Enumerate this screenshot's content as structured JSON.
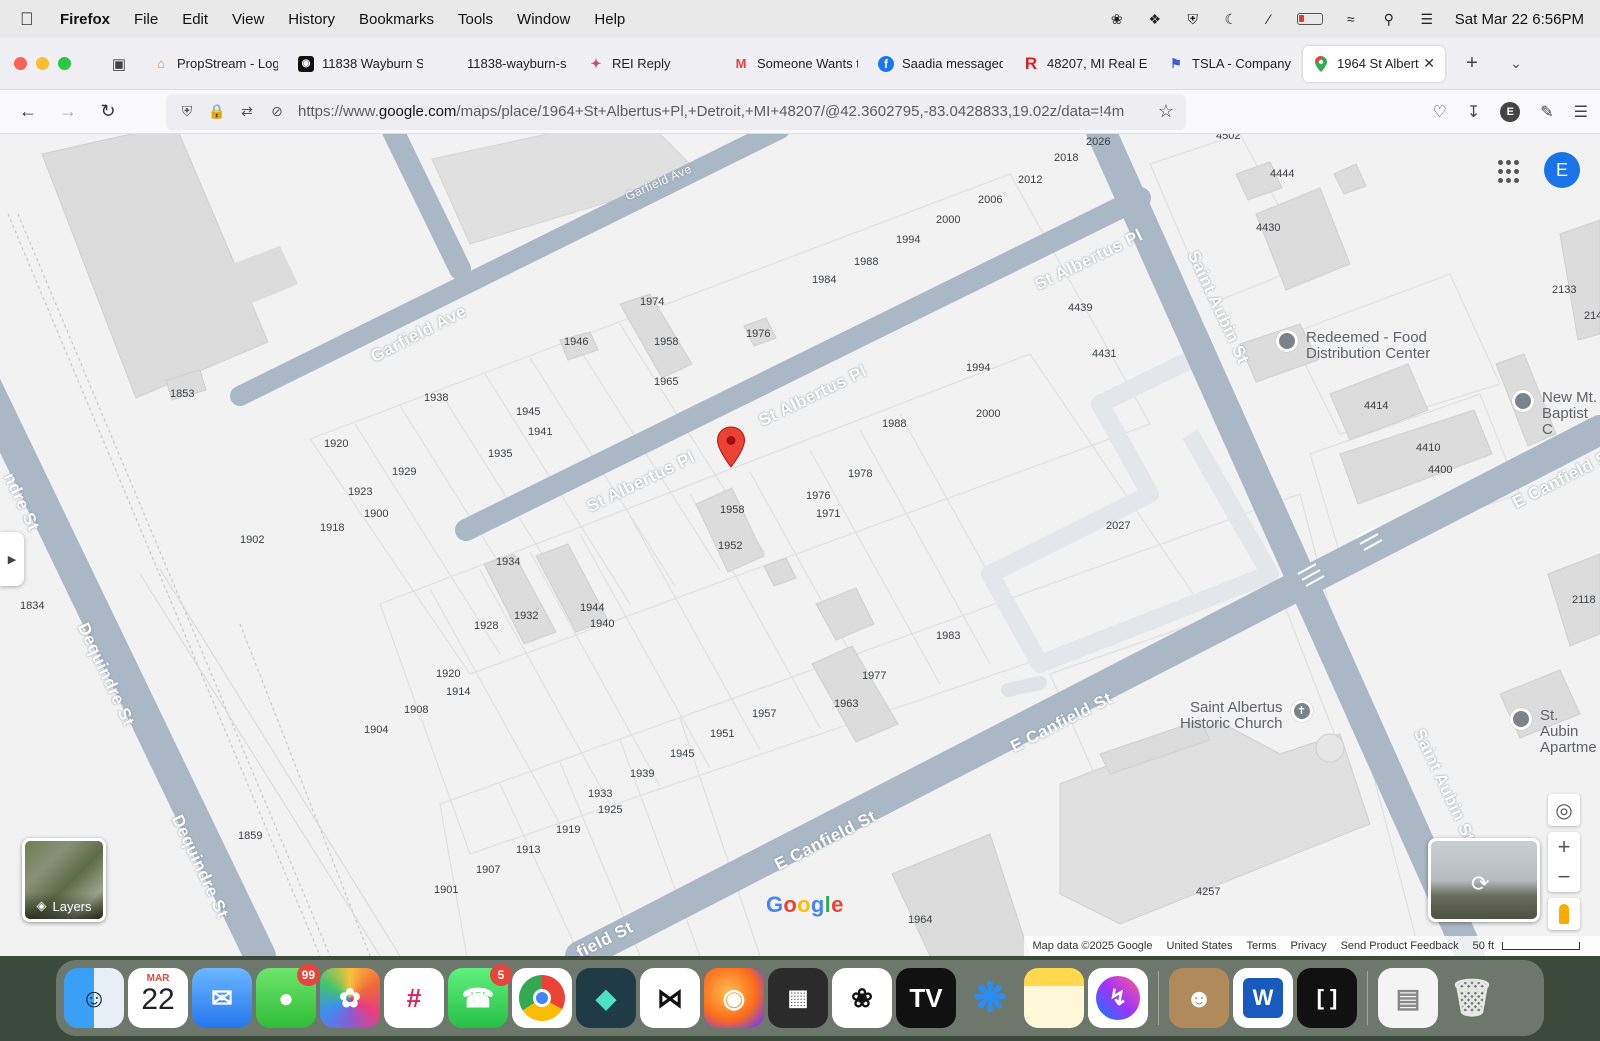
{
  "menubar": {
    "app": "Firefox",
    "items": [
      "File",
      "Edit",
      "View",
      "History",
      "Bookmarks",
      "Tools",
      "Window",
      "Help"
    ],
    "datetime": "Sat Mar 22  6:56PM"
  },
  "tabs": [
    {
      "label": "PropStream - Log",
      "icon": "house-icon",
      "color": "#e8893a"
    },
    {
      "label": "11838 Wayburn S",
      "icon": "black-square-icon",
      "color": "#111111"
    },
    {
      "label": "11838-wayburn-s",
      "icon": "none",
      "color": ""
    },
    {
      "label": "REI Reply",
      "icon": "rei-icon",
      "color": "#d04a7a"
    },
    {
      "label": "Someone Wants t",
      "icon": "gmail-icon",
      "color": "#ea4335"
    },
    {
      "label": "Saadia messaged",
      "icon": "facebook-icon",
      "color": "#1877f2"
    },
    {
      "label": "48207, MI Real E",
      "icon": "realtor-r-icon",
      "color": "#d92228"
    },
    {
      "label": "TSLA - Company",
      "icon": "flag-icon",
      "color": "#3b5bdb"
    },
    {
      "label": "1964 St Albert",
      "icon": "maps-pin-icon",
      "color": "#34a853",
      "active": true
    }
  ],
  "url": {
    "prefix": "https://www.",
    "host": "google.com",
    "rest": "/maps/place/1964+St+Albertus+Pl,+Detroit,+MI+48207/@42.3602795,-83.0428833,19.02z/data=!4m"
  },
  "map": {
    "streets": {
      "garfield_small": "Garfield Ave",
      "garfield": "Garfield Ave",
      "st_albertus_1": "St Albertus Pl",
      "st_albertus_2": "St Albertus Pl",
      "st_albertus_3": "St Albertus Pl",
      "saint_aubin_1": "Saint Aubin St",
      "saint_aubin_2": "Saint Aubin St",
      "dequindre_1": "Dequindre St",
      "dequindre_2": "Dequindre St",
      "dequindre_3": "ndre St",
      "canfield_1": "E Canfield St",
      "canfield_2": "E Canfield St",
      "canfield_3": "E Canfield St",
      "canfield_4": "field St"
    },
    "pois": {
      "redeemed_1": "Redeemed - Food",
      "redeemed_2": "Distribution Center",
      "newmt_1": "New Mt.",
      "newmt_2": "Baptist C",
      "church_1": "Saint Albertus",
      "church_2": "Historic Church",
      "aubin_1": "St. Aubin",
      "aubin_2": "Apartme"
    },
    "numbers": [
      "2026",
      "4502",
      "2018",
      "2012",
      "2006",
      "2000",
      "1994",
      "1988",
      "1984",
      "4444",
      "4430",
      "2133",
      "214",
      "1974",
      "1946",
      "1958",
      "1976",
      "1965",
      "4439",
      "4431",
      "1853",
      "1938",
      "1945",
      "1941",
      "1935",
      "1920",
      "1929",
      "1923",
      "1900",
      "1918",
      "1902",
      "1958",
      "1952",
      "1994",
      "2000",
      "1988",
      "1978",
      "1976",
      "1971",
      "4414",
      "4410",
      "4400",
      "2027",
      "1834",
      "1934",
      "1932",
      "1928",
      "1944",
      "1940",
      "1983",
      "2118",
      "1920",
      "1914",
      "1908",
      "1904",
      "1977",
      "1963",
      "1957",
      "1951",
      "1945",
      "1939",
      "1933",
      "1925",
      "1919",
      "1913",
      "1907",
      "1901",
      "1859",
      "1964",
      "4257"
    ],
    "layers_label": "Layers",
    "avatar_letter": "E",
    "google_logo": "Google",
    "footer": {
      "data": "Map data ©2025 Google",
      "country": "United States",
      "terms": "Terms",
      "privacy": "Privacy",
      "feedback": "Send Product Feedback",
      "scale": "50 ft"
    }
  },
  "dock": {
    "calendar_month": "MAR",
    "calendar_day": "22",
    "messages_badge": "99",
    "whatsapp_badge": "5"
  },
  "colors": {
    "road": "#aab7c4",
    "pin": "#ea4335",
    "block": "#e6e6e6",
    "building": "#dcdcdc"
  }
}
